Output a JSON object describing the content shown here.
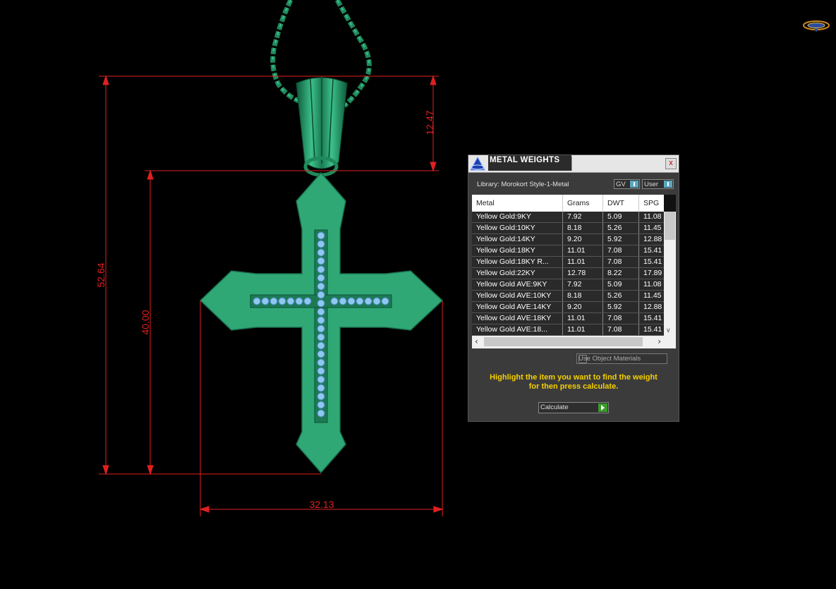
{
  "dimensions": {
    "total_height": "52.64",
    "body_height": "40.00",
    "bail_height": "12.47",
    "width": "32.13"
  },
  "dialog": {
    "title": "METAL WEIGHTS",
    "close_label": "x",
    "library": "Library: Morokort Style-1-Metal",
    "gv_label": "GV",
    "user_label": "User",
    "columns": [
      "Metal",
      "Grams",
      "DWT",
      "SPG"
    ],
    "rows": [
      [
        "Yellow Gold:9KY",
        "7.92",
        "5.09",
        "11.08"
      ],
      [
        "Yellow Gold:10KY",
        "8.18",
        "5.26",
        "11.45"
      ],
      [
        "Yellow Gold:14KY",
        "9.20",
        "5.92",
        "12.88"
      ],
      [
        "Yellow Gold:18KY",
        "11.01",
        "7.08",
        "15.41"
      ],
      [
        "Yellow Gold:18KY R...",
        "11.01",
        "7.08",
        "15.41"
      ],
      [
        "Yellow Gold:22KY",
        "12.78",
        "8.22",
        "17.89"
      ],
      [
        "Yellow Gold AVE:9KY",
        "7.92",
        "5.09",
        "11.08"
      ],
      [
        "Yellow Gold AVE:10KY",
        "8.18",
        "5.26",
        "11.45"
      ],
      [
        "Yellow Gold AVE:14KY",
        "9.20",
        "5.92",
        "12.88"
      ],
      [
        "Yellow Gold AVE:18KY",
        "11.01",
        "7.08",
        "15.41"
      ],
      [
        "Yellow Gold AVE:18...",
        "11.01",
        "7.08",
        "15.41"
      ]
    ],
    "use_object_materials": "Use Object Materials",
    "message_line1": "Highlight the item you want to find the weight",
    "message_line2": "for then press calculate.",
    "calculate_label": "Calculate"
  },
  "colors": {
    "background": "#000000",
    "dimension": "#e02020",
    "pendant": "#2fa876",
    "stones": "#8ec8f0",
    "message": "#f5d000"
  }
}
